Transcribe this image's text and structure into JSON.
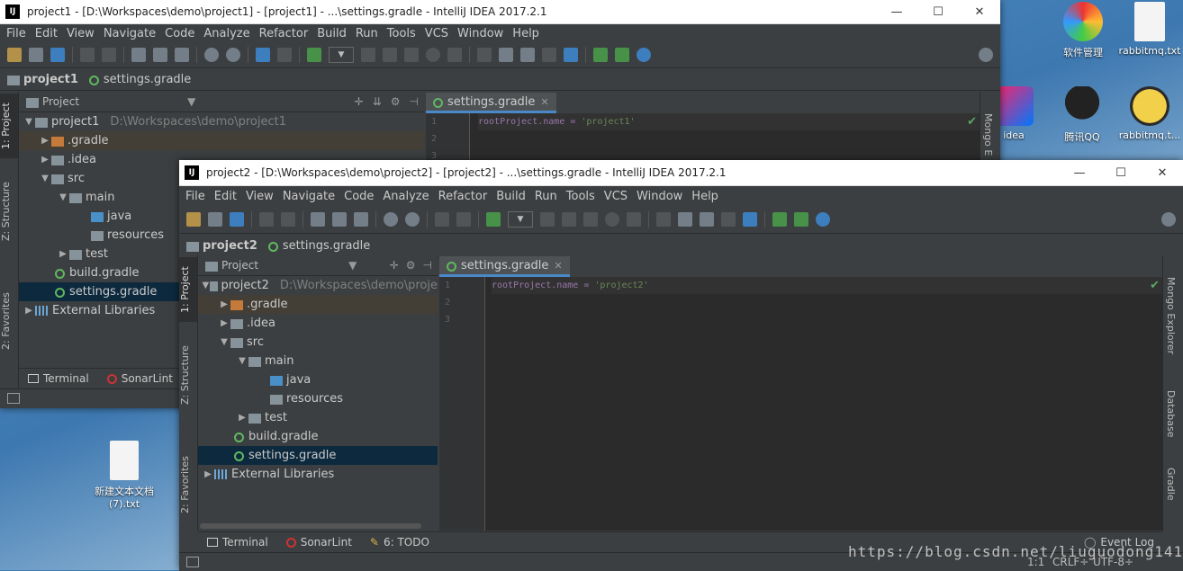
{
  "desktop": {
    "icons": [
      {
        "label": "软件管理"
      },
      {
        "label": "rabbitmq.txt"
      },
      {
        "label": "idea"
      },
      {
        "label": "腾讯QQ"
      },
      {
        "label": "rabbitmq.t..."
      },
      {
        "label": "新建文本文档\n(7).txt"
      }
    ],
    "watermark": "https://blog.csdn.net/liuguodong1413"
  },
  "win1": {
    "title": "project1 - [D:\\Workspaces\\demo\\project1] - [project1] - ...\\settings.gradle - IntelliJ IDEA 2017.2.1",
    "menu": [
      "File",
      "Edit",
      "View",
      "Navigate",
      "Code",
      "Analyze",
      "Refactor",
      "Build",
      "Run",
      "Tools",
      "VCS",
      "Window",
      "Help"
    ],
    "breadcrumb": [
      "project1",
      "settings.gradle"
    ],
    "panel_title": "Project",
    "tree": [
      {
        "label": "project1",
        "path": "D:\\Workspaces\\demo\\project1"
      },
      {
        "label": ".gradle"
      },
      {
        "label": ".idea"
      },
      {
        "label": "src"
      },
      {
        "label": "main"
      },
      {
        "label": "java"
      },
      {
        "label": "resources"
      },
      {
        "label": "test"
      },
      {
        "label": "build.gradle"
      },
      {
        "label": "settings.gradle"
      },
      {
        "label": "External Libraries"
      }
    ],
    "tab": "settings.gradle",
    "lines": [
      "1",
      "2",
      "3"
    ],
    "code_prop": "rootProject.name = ",
    "code_str": "'project1'",
    "left_tools": [
      "1: Project",
      "Z: Structure",
      "2: Favorites"
    ],
    "right_tools": [
      "Mongo E"
    ],
    "bottom": [
      "Terminal",
      "SonarLint"
    ]
  },
  "win2": {
    "title": "project2 - [D:\\Workspaces\\demo\\project2] - [project2] - ...\\settings.gradle - IntelliJ IDEA 2017.2.1",
    "menu": [
      "File",
      "Edit",
      "View",
      "Navigate",
      "Code",
      "Analyze",
      "Refactor",
      "Build",
      "Run",
      "Tools",
      "VCS",
      "Window",
      "Help"
    ],
    "breadcrumb": [
      "project2",
      "settings.gradle"
    ],
    "panel_title": "Project",
    "tree": [
      {
        "label": "project2",
        "path": "D:\\Workspaces\\demo\\proje"
      },
      {
        "label": ".gradle"
      },
      {
        "label": ".idea"
      },
      {
        "label": "src"
      },
      {
        "label": "main"
      },
      {
        "label": "java"
      },
      {
        "label": "resources"
      },
      {
        "label": "test"
      },
      {
        "label": "build.gradle"
      },
      {
        "label": "settings.gradle"
      },
      {
        "label": "External Libraries"
      }
    ],
    "tab": "settings.gradle",
    "lines": [
      "1",
      "2",
      "3"
    ],
    "code_prop": "rootProject.name = ",
    "code_str": "'project2'",
    "left_tools": [
      "1: Project",
      "Z: Structure",
      "2: Favorites"
    ],
    "right_tools": [
      "Mongo Explorer",
      "Database",
      "Gradle"
    ],
    "bottom": [
      "Terminal",
      "SonarLint",
      "6: TODO"
    ],
    "event_log": "Event Log",
    "status": {
      "pos": "1:1",
      "crlf": "CRLF÷",
      "enc": "UTF-8÷"
    }
  }
}
